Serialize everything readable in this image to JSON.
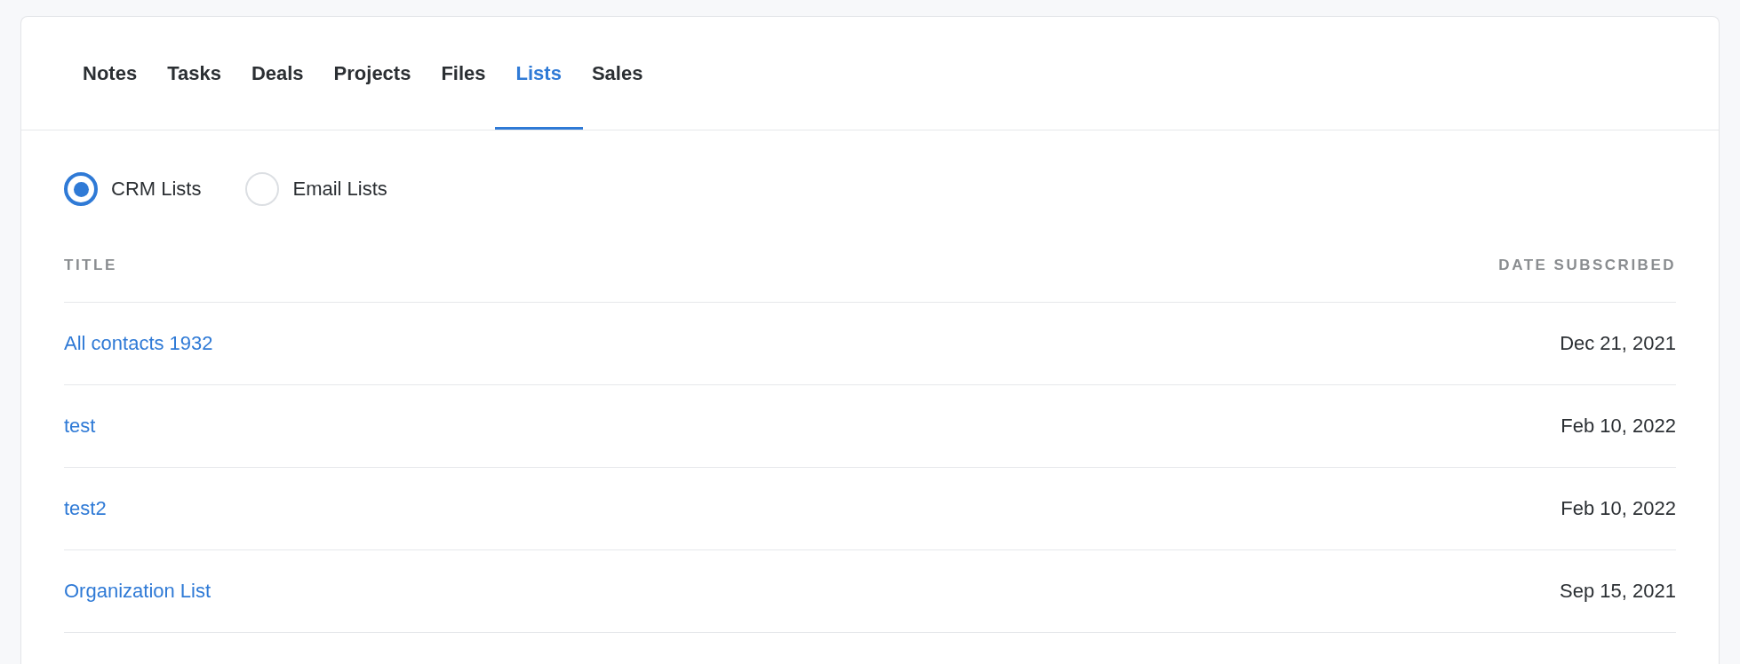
{
  "tabs": [
    {
      "label": "Notes",
      "selected": false
    },
    {
      "label": "Tasks",
      "selected": false
    },
    {
      "label": "Deals",
      "selected": false
    },
    {
      "label": "Projects",
      "selected": false
    },
    {
      "label": "Files",
      "selected": false
    },
    {
      "label": "Lists",
      "selected": true
    },
    {
      "label": "Sales",
      "selected": false
    }
  ],
  "list_type": [
    {
      "label": "CRM Lists",
      "selected": true
    },
    {
      "label": "Email Lists",
      "selected": false
    }
  ],
  "table": {
    "columns": [
      "TITLE",
      "DATE SUBSCRIBED"
    ],
    "rows": [
      {
        "title": "All contacts 1932",
        "date_subscribed": "Dec 21, 2021"
      },
      {
        "title": "test",
        "date_subscribed": "Feb 10, 2022"
      },
      {
        "title": "test2",
        "date_subscribed": "Feb 10, 2022"
      },
      {
        "title": "Organization List",
        "date_subscribed": "Sep 15, 2021"
      }
    ]
  }
}
